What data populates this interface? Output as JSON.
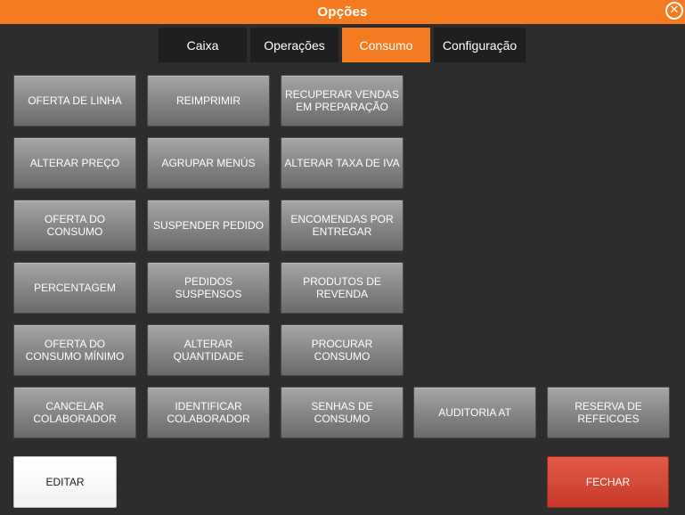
{
  "window": {
    "title": "Opções",
    "close_icon": "close-icon",
    "close_glyph": "✕"
  },
  "tabs": [
    {
      "label": "Caixa",
      "active": false
    },
    {
      "label": "Operações",
      "active": false
    },
    {
      "label": "Consumo",
      "active": true
    },
    {
      "label": "Configuração",
      "active": false
    }
  ],
  "buttons": [
    "OFERTA DE LINHA",
    "REIMPRIMIR",
    "RECUPERAR VENDAS EM PREPARAÇÃO",
    "ALTERAR PREÇO",
    "AGRUPAR MENÚS",
    "ALTERAR TAXA DE IVA",
    "OFERTA DO CONSUMO",
    "SUSPENDER PEDIDO",
    "ENCOMENDAS POR ENTREGAR",
    "PERCENTAGEM",
    "PEDIDOS SUSPENSOS",
    "PRODUTOS DE REVENDA",
    "OFERTA DO CONSUMO MÍNIMO",
    "ALTERAR QUANTIDADE",
    "PROCURAR CONSUMO",
    "CANCELAR COLABORADOR",
    "IDENTIFICAR COLABORADOR",
    "SENHAS DE CONSUMO",
    "AUDITORIA AT",
    "RESERVA DE REFEICOES"
  ],
  "footer": {
    "edit_label": "EDITAR",
    "close_label": "FECHAR"
  },
  "colors": {
    "accent": "#f47b20",
    "background": "#2d2d2d",
    "tab_bg": "#1f1f1f",
    "button_gray": "#8a8a8a",
    "close_red": "#d14a38"
  }
}
